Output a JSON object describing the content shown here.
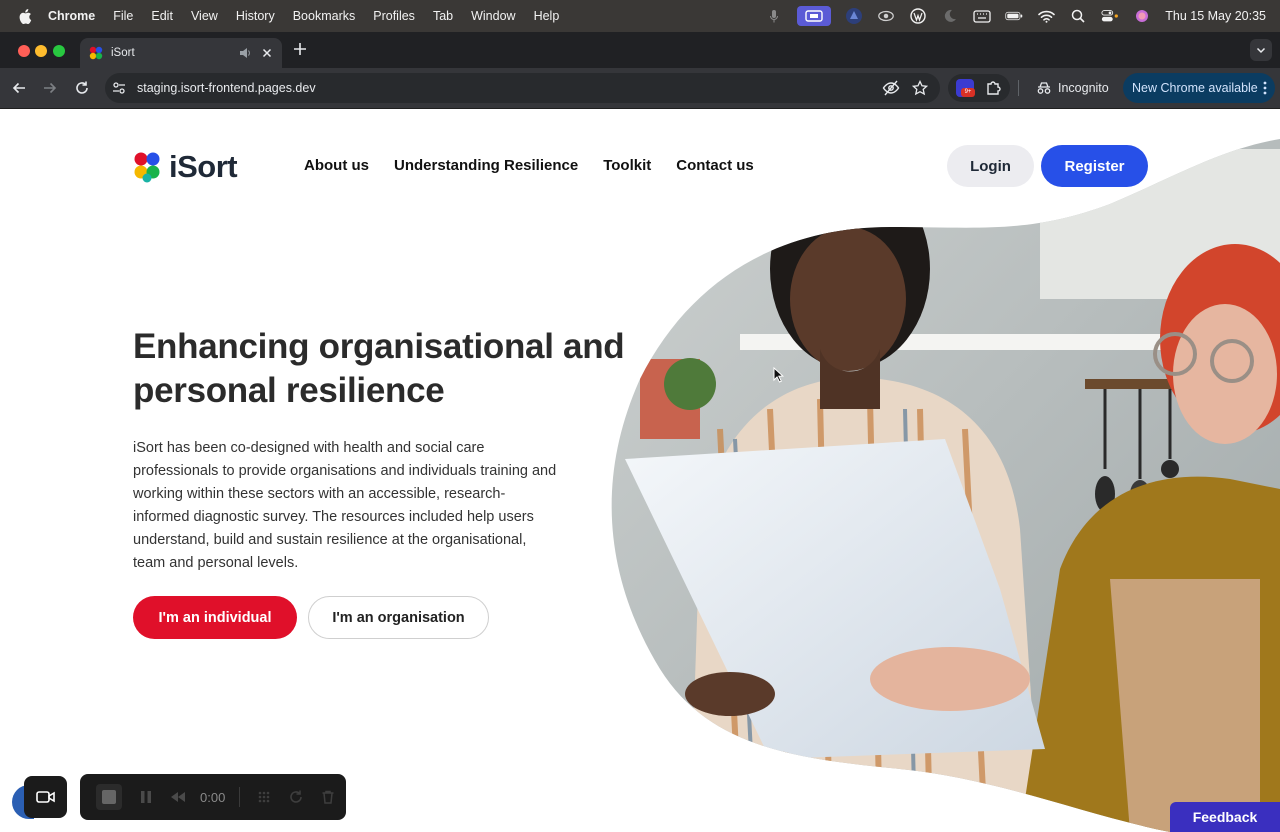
{
  "menubar": {
    "app_name": "Chrome",
    "items": [
      "File",
      "Edit",
      "View",
      "History",
      "Bookmarks",
      "Profiles",
      "Tab",
      "Window",
      "Help"
    ],
    "clock": "Thu 15 May  20:35"
  },
  "browser": {
    "tab_title": "iSort",
    "url": "staging.isort-frontend.pages.dev",
    "incognito_label": "Incognito",
    "update_label": "New Chrome available",
    "extension_badge": "9+"
  },
  "site": {
    "logo_text": "iSort",
    "nav": [
      "About us",
      "Understanding Resilience",
      "Toolkit",
      "Contact us"
    ],
    "login_label": "Login",
    "register_label": "Register",
    "hero_title": "Enhancing organisational and personal resilience",
    "hero_text": "iSort has been co-designed with health and social care professionals to provide organisations and individuals training and working within these sectors with an accessible, research-informed diagnostic survey. The resources included help users understand, build and sustain resilience at the organisational, team and personal levels.",
    "individual_label": "I'm an individual",
    "organisation_label": "I'm an organisation",
    "feedback_label": "Feedback"
  },
  "recorder": {
    "time": "0:00"
  },
  "colors": {
    "primary_blue": "#2750e8",
    "accent_red": "#e0102a",
    "feedback_purple": "#3a2fbf"
  }
}
